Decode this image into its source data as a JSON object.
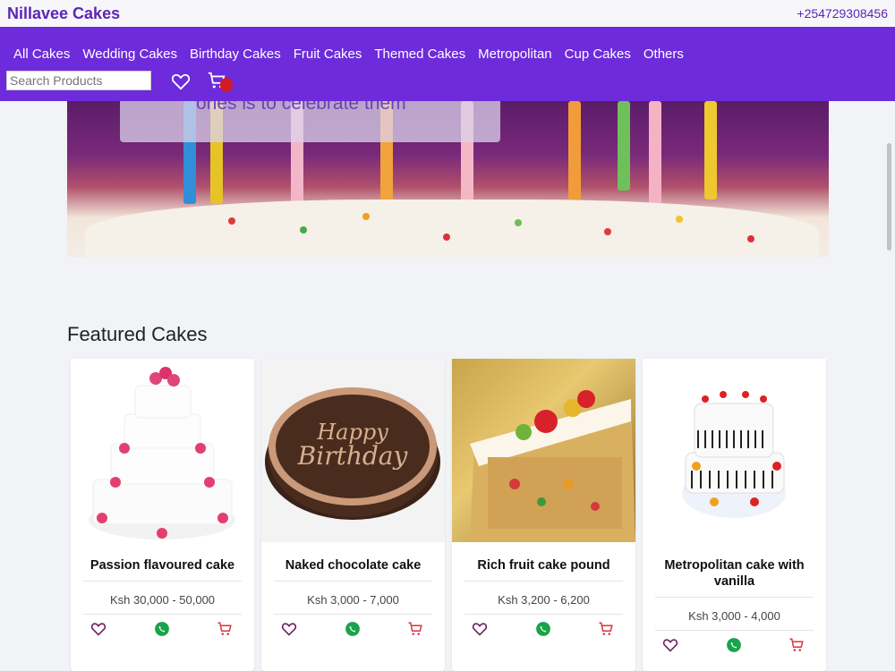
{
  "header": {
    "brand": "Nillavee Cakes",
    "phone": "+254729308456"
  },
  "nav": {
    "links": [
      "All Cakes",
      "Wedding Cakes",
      "Birthday Cakes",
      "Fruit Cakes",
      "Themed Cakes",
      "Metropolitan",
      "Cup Cakes",
      "Others"
    ],
    "search_placeholder": "Search Products"
  },
  "hero": {
    "text": "ones is to celebrate them"
  },
  "featured": {
    "title": "Featured Cakes",
    "products": [
      {
        "name": "Passion flavoured cake",
        "price": "Ksh 30,000 - 50,000"
      },
      {
        "name": "Naked chocolate cake",
        "price": "Ksh 3,000 - 7,000"
      },
      {
        "name": "Rich fruit cake pound",
        "price": "Ksh 3,200 - 6,200"
      },
      {
        "name": "Metropolitan cake with vanilla",
        "price": "Ksh 3,000 - 4,000"
      }
    ]
  },
  "colors": {
    "brand": "#5b26b8",
    "nav": "#6d2bdb",
    "heart": "#6b1f5f",
    "whatsapp": "#1aa34a",
    "cart": "#d9363e"
  },
  "icons": [
    "heart-icon",
    "cart-icon",
    "whatsapp-icon"
  ]
}
